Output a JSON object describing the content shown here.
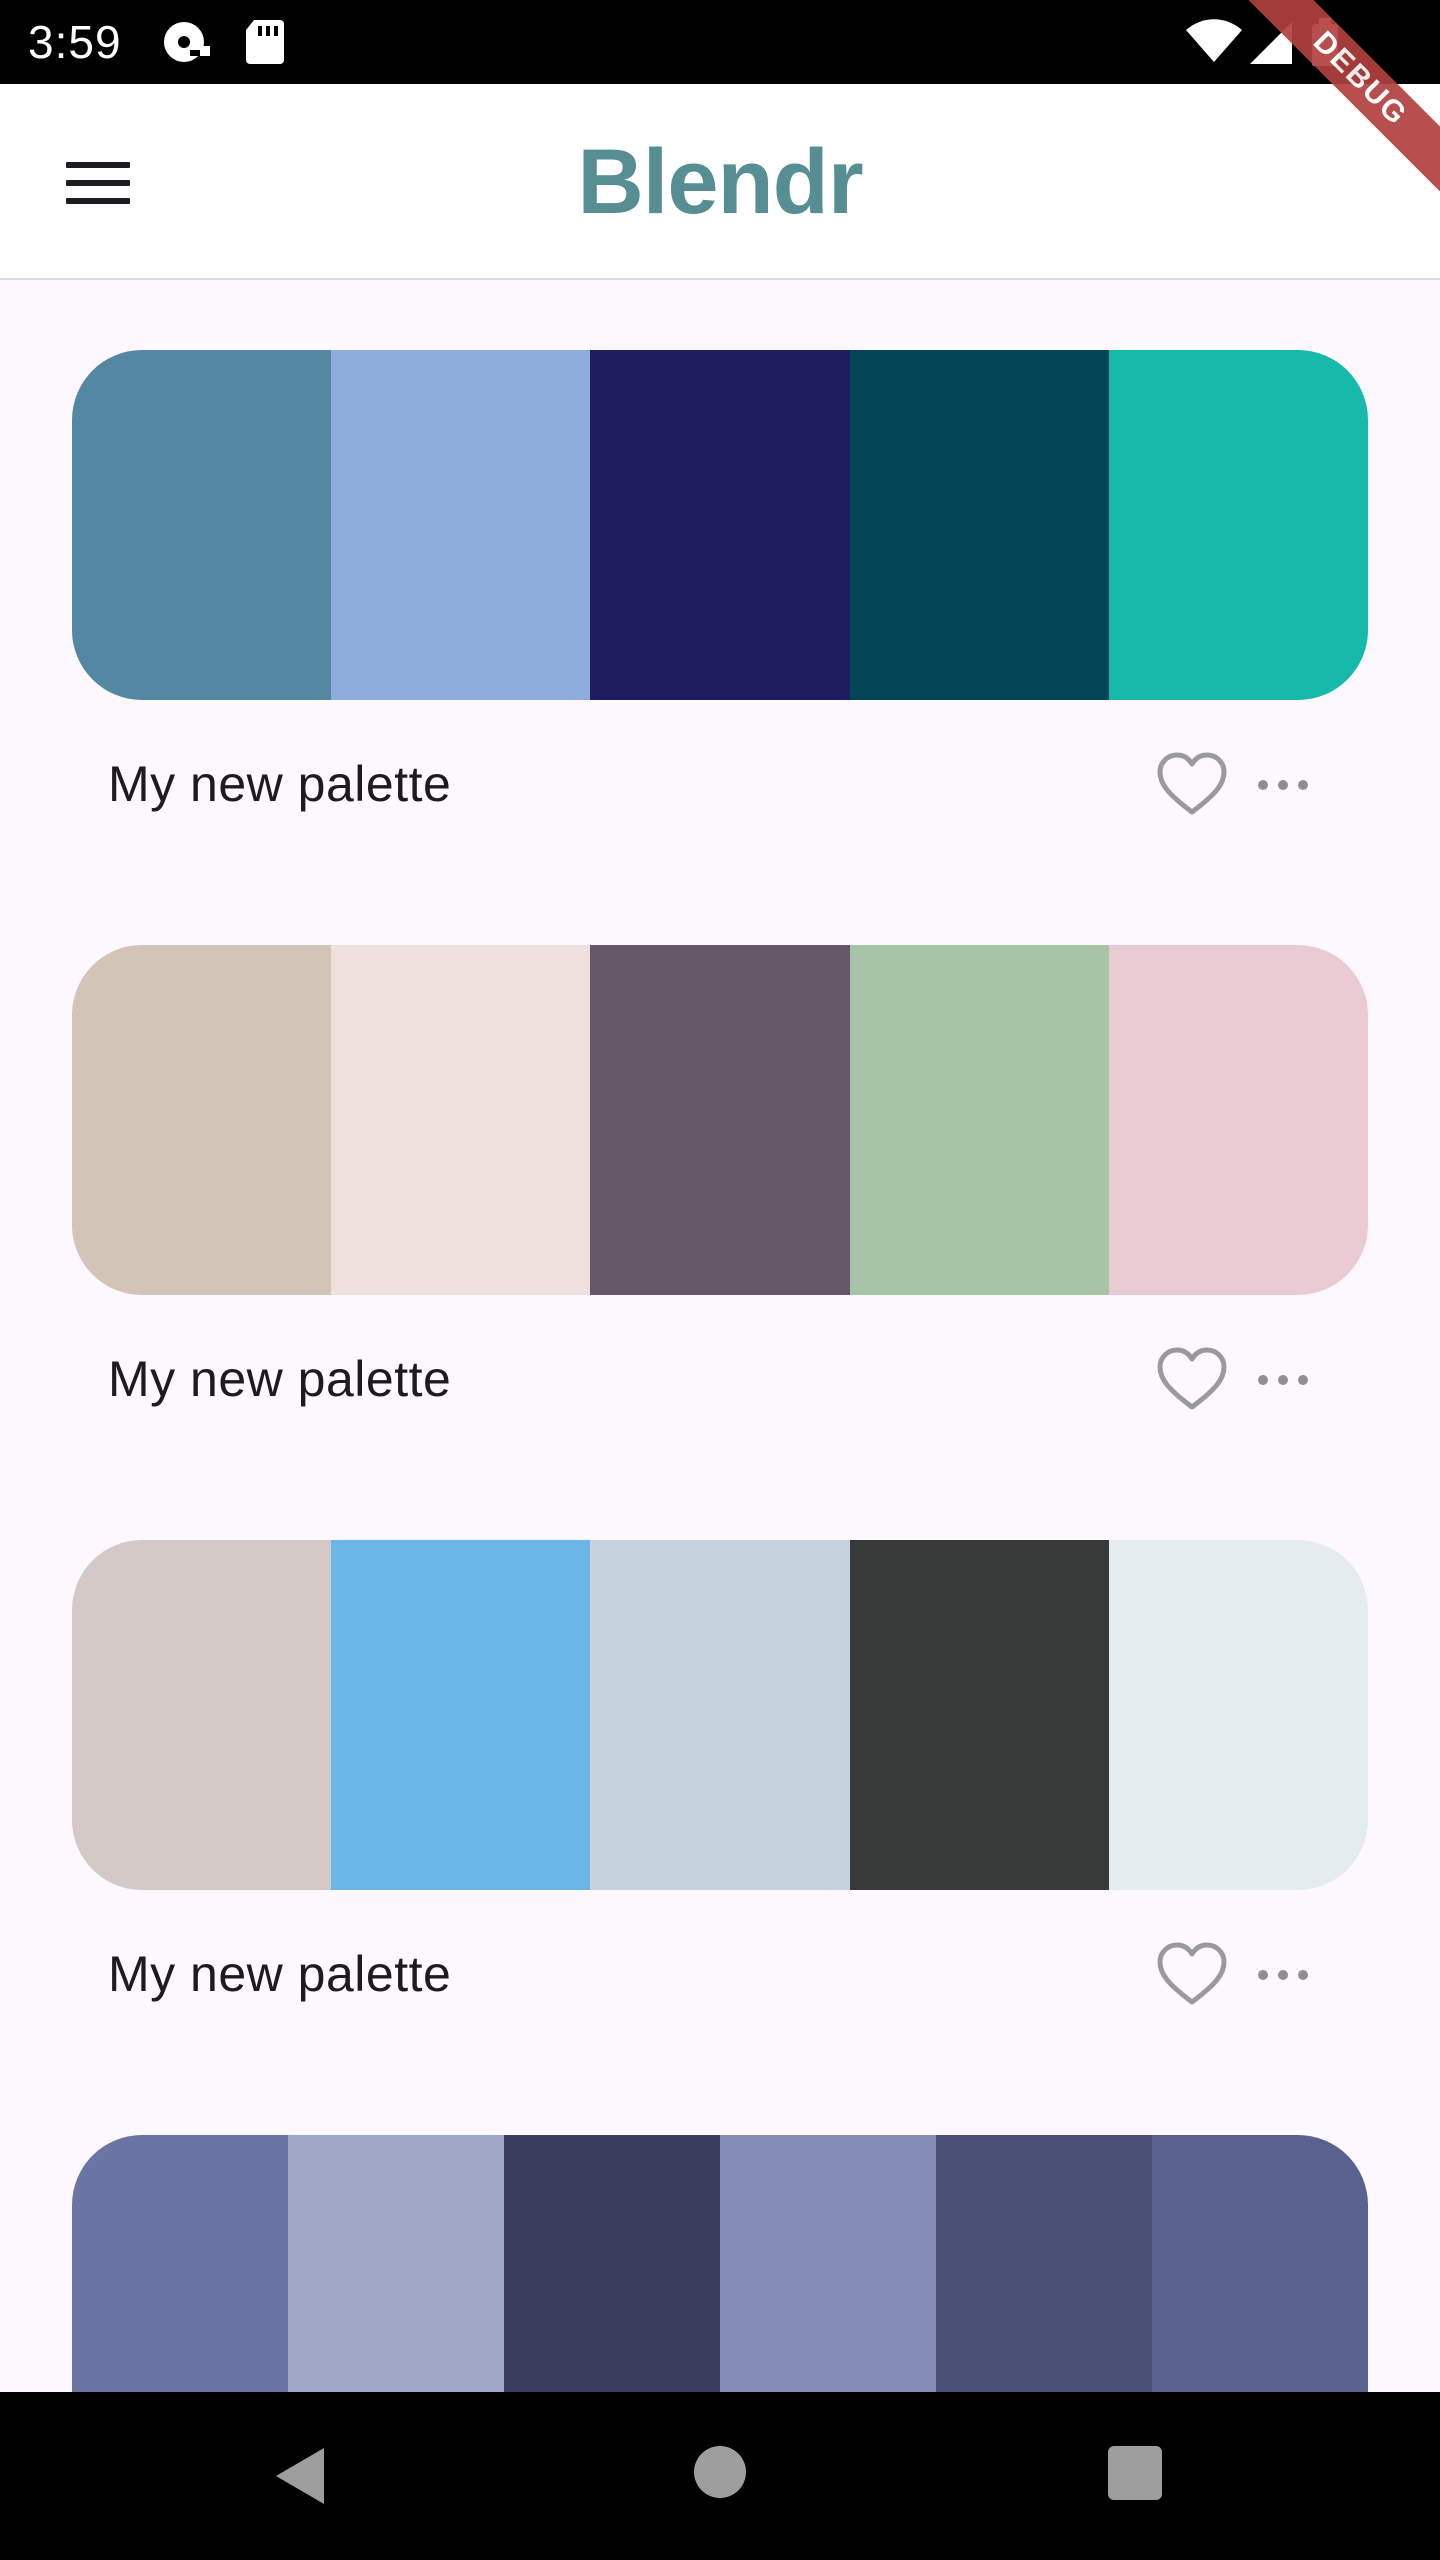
{
  "status_bar": {
    "time": "3:59",
    "icons": [
      "download-icon",
      "sd-card-icon",
      "wifi-icon",
      "signal-icon",
      "battery-icon"
    ],
    "debug_label": "DEBUG"
  },
  "app_bar": {
    "title": "Blendr",
    "title_color": "#568e93",
    "menu_icon": "hamburger-menu-icon"
  },
  "palettes": [
    {
      "name": "My new palette",
      "colors": [
        "#5487a2",
        "#8eacdc",
        "#1f1c60",
        "#044555",
        "#16b9aa"
      ],
      "favorite_icon": "heart-outline-icon",
      "more_icon": "more-horizontal-icon"
    },
    {
      "name": "My new palette",
      "colors": [
        "#d2c5b7",
        "#eee1dd",
        "#655767",
        "#a7c4a6",
        "#eacbd3"
      ],
      "favorite_icon": "heart-outline-icon",
      "more_icon": "more-horizontal-icon"
    },
    {
      "name": "My new palette",
      "colors": [
        "#d5c9c8",
        "#6ab6e6",
        "#c4d3dd",
        "#383a3a",
        "#e5ecf0"
      ],
      "favorite_icon": "heart-outline-icon",
      "more_icon": "more-horizontal-icon"
    },
    {
      "name": "",
      "colors": [
        "#6b75a4",
        "#a1a7c7",
        "#3a3d5c",
        "#858cb7",
        "#4a5075",
        "#59628f"
      ]
    }
  ],
  "nav_bar": {
    "icons": [
      "back-icon",
      "home-icon",
      "recents-icon"
    ]
  }
}
